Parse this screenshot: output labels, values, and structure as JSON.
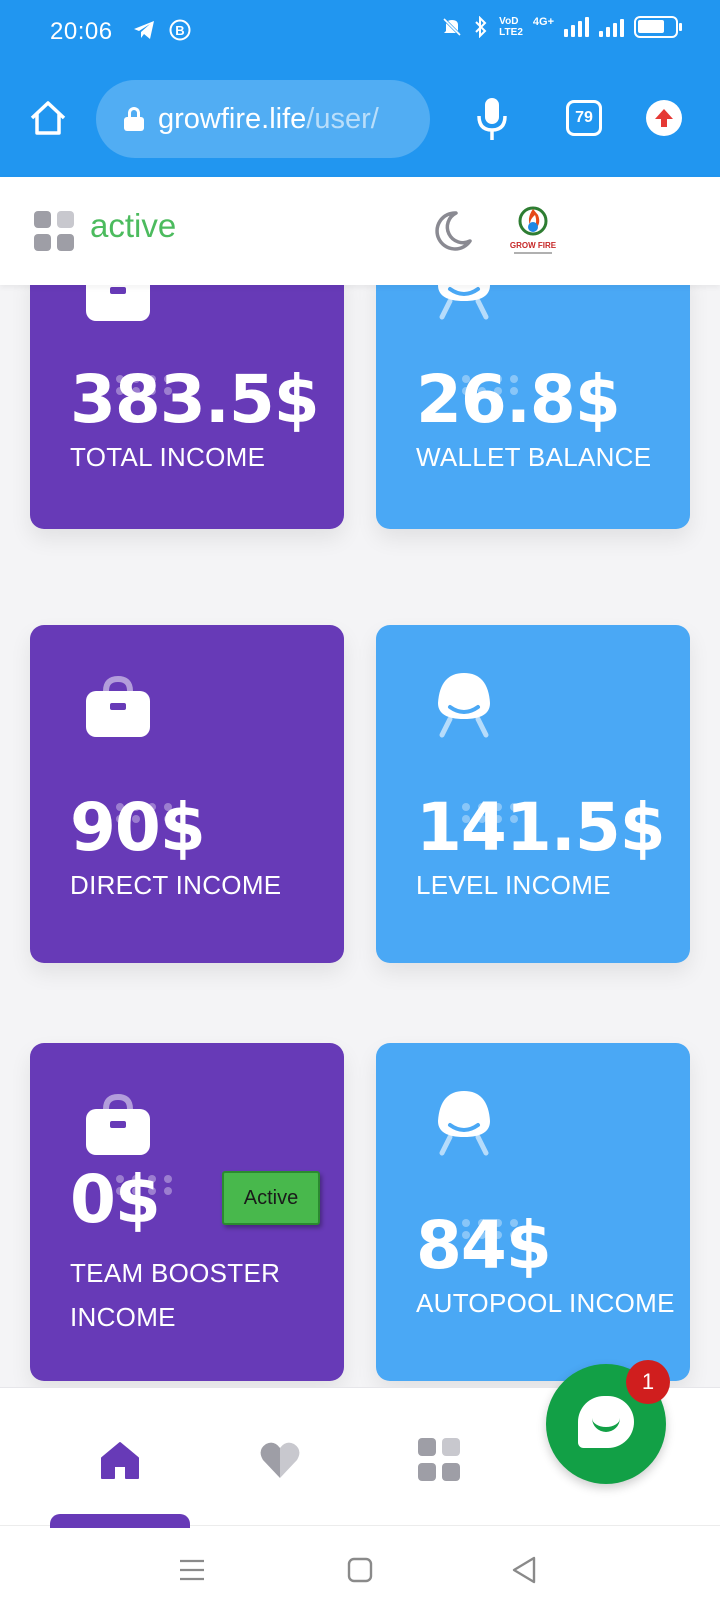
{
  "status_bar": {
    "time": "20:06",
    "network_badge_top": "VoD",
    "network_badge_bottom": "LTE2",
    "network_type": "4G+",
    "battery_level": 0.75
  },
  "browser": {
    "url_host": "growfire.life",
    "url_path": "/user/",
    "tab_count": "79"
  },
  "header": {
    "status": "active",
    "logo_text": "GROW FIRE"
  },
  "cards": [
    {
      "value": "383.5$",
      "label": "TOTAL INCOME",
      "color": "#673ab7",
      "icon": "briefcase-icon"
    },
    {
      "value": "26.8$",
      "label": "WALLET BALANCE",
      "color": "#4aa8f5",
      "icon": "chair-icon"
    },
    {
      "value": "90$",
      "label": "DIRECT INCOME",
      "color": "#673ab7",
      "icon": "briefcase-icon"
    },
    {
      "value": "141.5$",
      "label": "LEVEL INCOME",
      "color": "#4aa8f5",
      "icon": "chair-icon"
    },
    {
      "value": "0$",
      "label": "TEAM BOOSTER INCOME",
      "color": "#673ab7",
      "icon": "briefcase-icon",
      "badge": "Active"
    },
    {
      "value": "84$",
      "label": "AUTOPOOL INCOME",
      "color": "#4aa8f5",
      "icon": "chair-icon"
    }
  ],
  "chat": {
    "unread_count": "1"
  },
  "colors": {
    "primary": "#673ab7",
    "secondary": "#4aa8f5",
    "browser": "#2196f0",
    "success": "#4cbb5e"
  }
}
